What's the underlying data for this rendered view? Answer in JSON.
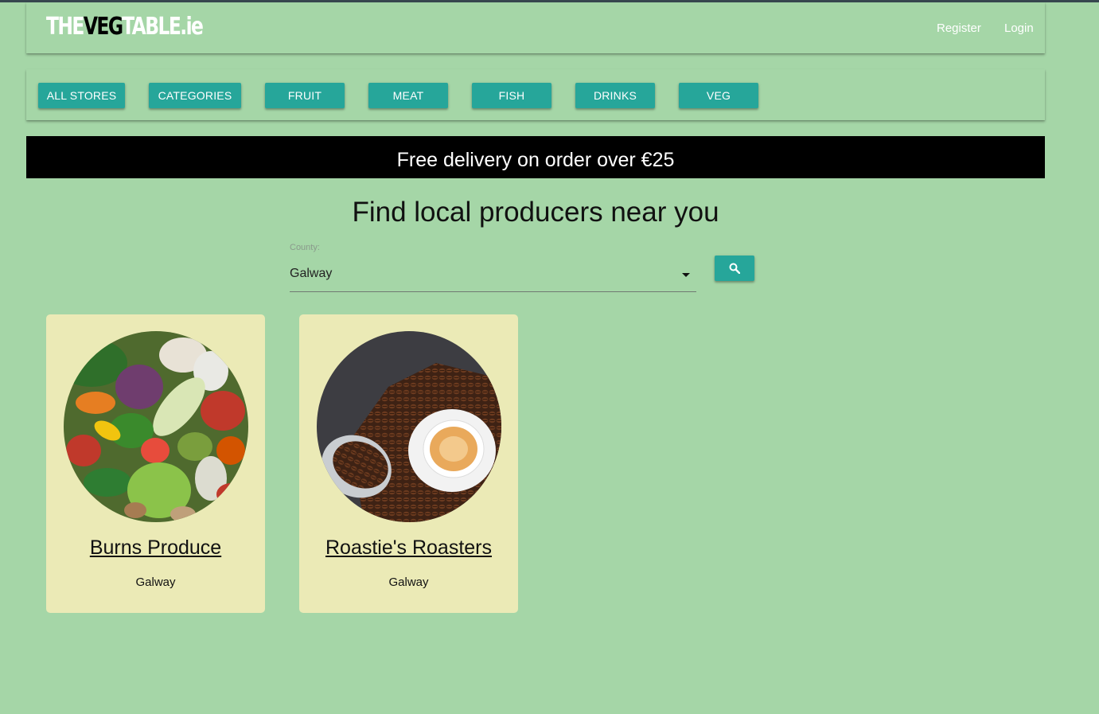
{
  "header": {
    "logo": {
      "part1": "THE",
      "part2": "VEG",
      "part3": "TABLE.ie"
    },
    "register_label": "Register",
    "login_label": "Login"
  },
  "categories": [
    {
      "label": "ALL STORES"
    },
    {
      "label": "CATEGORIES"
    },
    {
      "label": "FRUIT"
    },
    {
      "label": "MEAT"
    },
    {
      "label": "FISH"
    },
    {
      "label": "DRINKS"
    },
    {
      "label": "VEG"
    }
  ],
  "promo": {
    "text": "Free delivery on order over €25"
  },
  "main": {
    "title": "Find local producers near you",
    "county_label": "County:",
    "county_value": "Galway",
    "search_icon": "search-icon"
  },
  "stores": [
    {
      "name": "Burns Produce",
      "county": "Galway",
      "image": "vegetables-photo"
    },
    {
      "name": "Roastie's Roasters",
      "county": "Galway",
      "image": "coffee-beans-photo"
    }
  ],
  "colors": {
    "background": "#a5d6a7",
    "button": "#26a69a",
    "card": "#ebeab6",
    "banner": "#000000"
  }
}
